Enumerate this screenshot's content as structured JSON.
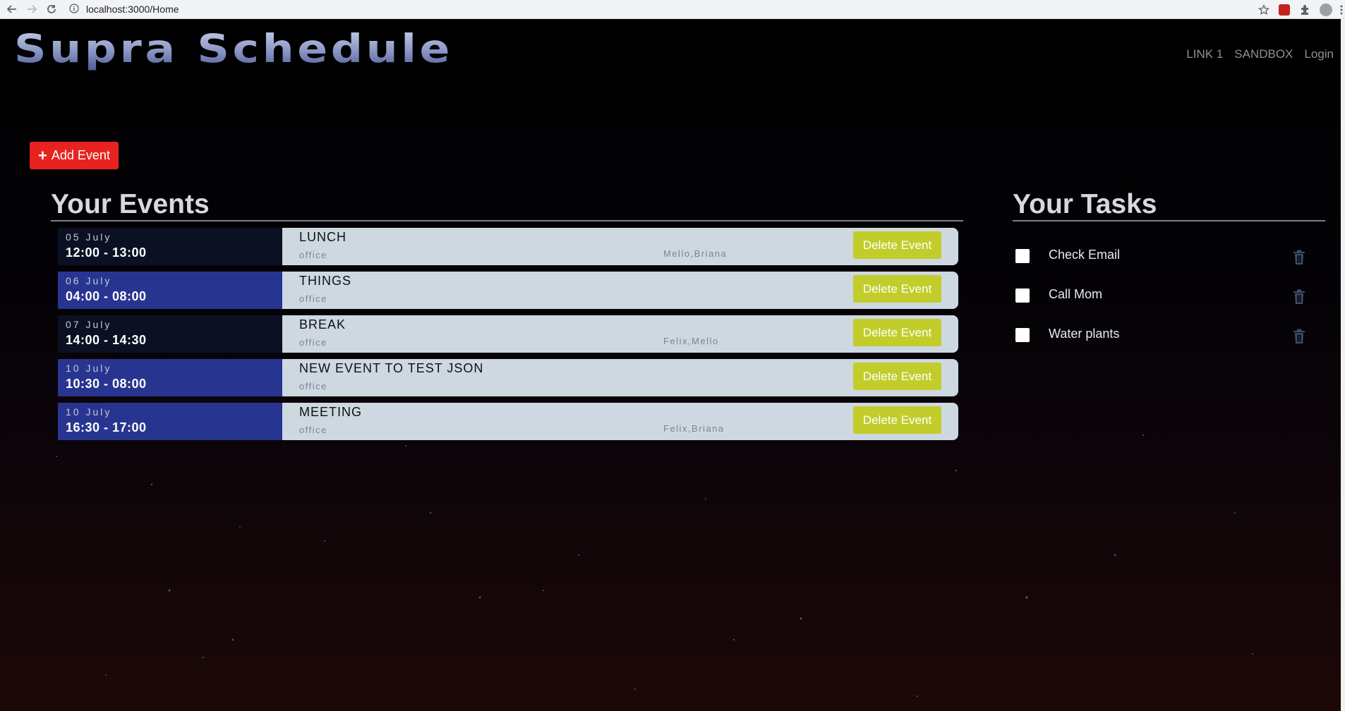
{
  "browser": {
    "url": "localhost:3000/Home"
  },
  "header": {
    "brand": "Supra Schedule",
    "nav": [
      {
        "label": "LINK 1"
      },
      {
        "label": "SANDBOX"
      },
      {
        "label": "Login"
      }
    ]
  },
  "actions": {
    "add_event_label": "Add Event"
  },
  "events_section": {
    "title": "Your Events",
    "delete_label": "Delete Event",
    "items": [
      {
        "date": "05 July",
        "time": "12:00 - 13:00",
        "title": "LUNCH",
        "location": "office",
        "people": "Mello,Briana"
      },
      {
        "date": "06 July",
        "time": "04:00 - 08:00",
        "title": "THINGS",
        "location": "office",
        "people": ""
      },
      {
        "date": "07 July",
        "time": "14:00 - 14:30",
        "title": "BREAK",
        "location": "office",
        "people": "Felix,Mello"
      },
      {
        "date": "10 July",
        "time": "10:30 - 08:00",
        "title": "NEW EVENT TO TEST JSON",
        "location": "office",
        "people": ""
      },
      {
        "date": "10 July",
        "time": "16:30 - 17:00",
        "title": "MEETING",
        "location": "office",
        "people": "Felix,Briana"
      }
    ]
  },
  "tasks_section": {
    "title": "Your Tasks",
    "items": [
      {
        "label": "Check Email",
        "checked": false
      },
      {
        "label": "Call Mom",
        "checked": false
      },
      {
        "label": "Water plants",
        "checked": false
      }
    ]
  },
  "colors": {
    "add_button": "#e8231f",
    "delete_button": "#c2cd2b",
    "event_dark": "#0b1022",
    "event_blue": "#283590",
    "event_body": "#cdd8e1"
  }
}
